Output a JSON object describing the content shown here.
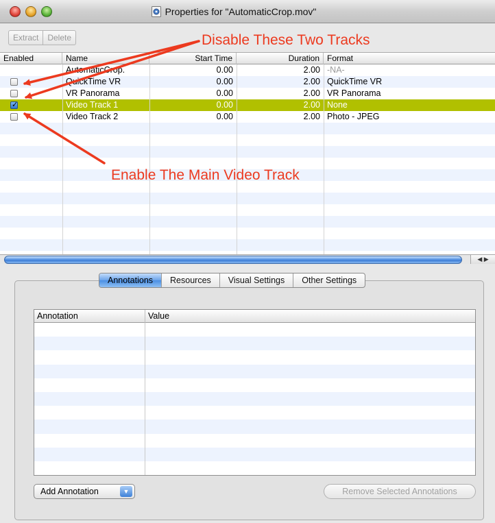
{
  "window": {
    "title": "Properties for \"AutomaticCrop.mov\""
  },
  "toolbar": {
    "extract_label": "Extract",
    "delete_label": "Delete"
  },
  "tracks": {
    "columns": {
      "enabled": "Enabled",
      "name": "Name",
      "start_time": "Start Time",
      "duration": "Duration",
      "format": "Format"
    },
    "rows": [
      {
        "name": "AutomaticCrop.",
        "start_time": "0.00",
        "duration": "2.00",
        "format": "-NA-",
        "has_checkbox": false,
        "enabled": false
      },
      {
        "name": "QuickTime VR",
        "start_time": "0.00",
        "duration": "2.00",
        "format": "QuickTime VR",
        "has_checkbox": true,
        "enabled": false
      },
      {
        "name": "VR Panorama",
        "start_time": "0.00",
        "duration": "2.00",
        "format": "VR Panorama",
        "has_checkbox": true,
        "enabled": false
      },
      {
        "name": "Video Track 1",
        "start_time": "0.00",
        "duration": "2.00",
        "format": "None",
        "has_checkbox": true,
        "enabled": true,
        "selected": true
      },
      {
        "name": "Video Track 2",
        "start_time": "0.00",
        "duration": "2.00",
        "format": "Photo - JPEG",
        "has_checkbox": true,
        "enabled": false
      }
    ]
  },
  "tabs": [
    {
      "label": "Annotations",
      "active": true
    },
    {
      "label": "Resources",
      "active": false
    },
    {
      "label": "Visual Settings",
      "active": false
    },
    {
      "label": "Other Settings",
      "active": false
    }
  ],
  "annotations": {
    "col_annotation": "Annotation",
    "col_value": "Value",
    "add_button": "Add Annotation",
    "remove_button": "Remove Selected Annotations"
  },
  "callouts": {
    "disable": "Disable  These Two Tracks",
    "enable": "Enable The Main Video Track"
  },
  "colors": {
    "selection": "#b1c000",
    "callout": "#ec3a1f",
    "stripe": "#edf3fe"
  }
}
